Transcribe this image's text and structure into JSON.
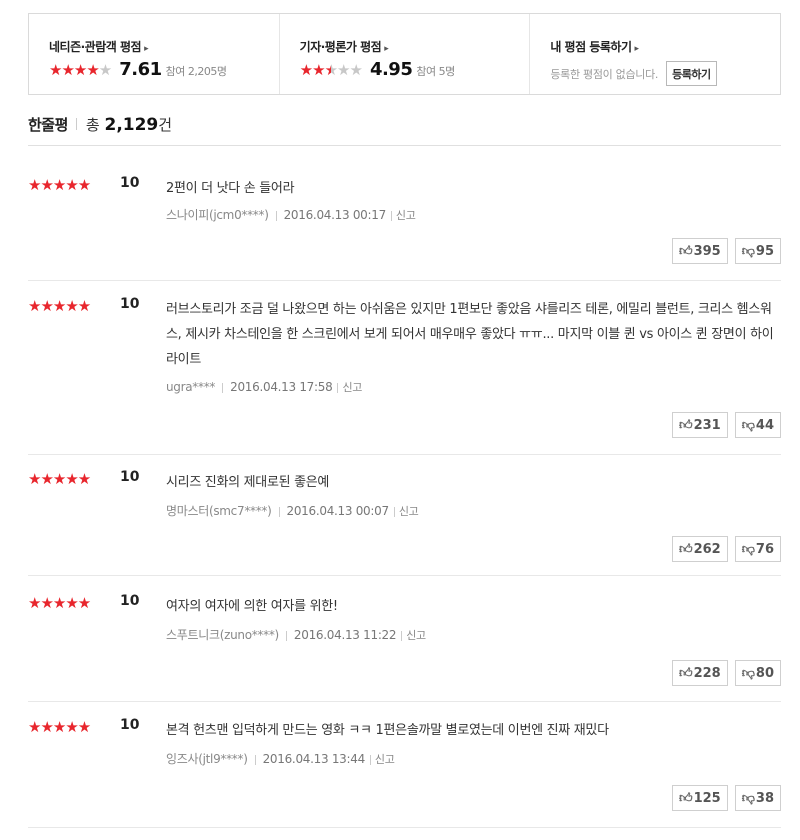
{
  "summary": {
    "netizen": {
      "label": "네티즌·관람객 평점",
      "arrow": "▸",
      "stars_on": "★★★★",
      "stars_off": "★",
      "score": "7.61",
      "participants": "참여 2,205명"
    },
    "critic": {
      "label": "기자·평론가 평점",
      "arrow": "▸",
      "stars_on": "★★",
      "stars_half": "★",
      "stars_off": "★★",
      "score": "4.95",
      "participants": "참여 5명"
    },
    "mine": {
      "label": "내 평점 등록하기",
      "arrow": "▸",
      "empty_text": "등록한 평점이 없습니다.",
      "button_label": "등록하기"
    }
  },
  "heading": {
    "title": "한줄평",
    "total_prefix": "총 ",
    "count": "2,129",
    "suffix": "건"
  },
  "colors": {
    "star": "#e8262d",
    "star_off": "#c8c8c8"
  },
  "reviews": [
    {
      "stars": "★★★★★",
      "score": "10",
      "text": "2편이 더 낫다 손 들어라",
      "user": "스나이피(jcm0****)",
      "date": "2016.04.13 00:17",
      "report": "신고",
      "up": "395",
      "down": "95"
    },
    {
      "stars": "★★★★★",
      "score": "10",
      "text": "러브스토리가 조금 덜 나왔으면 하는 아쉬움은 있지만 1편보단 좋았음 샤를리즈 테론, 에밀리 블런트, 크리스 헴스워스, 제시카 차스테인을 한 스크린에서 보게 되어서 매우매우 좋았다 ㅠㅠ... 마지막 이블 퀸 vs 아이스 퀸 장면이 하이라이트",
      "user": "ugra****",
      "date": "2016.04.13 17:58",
      "report": "신고",
      "up": "231",
      "down": "44"
    },
    {
      "stars": "★★★★★",
      "score": "10",
      "text": "시리즈 진화의 제대로된 좋은예",
      "user": "명마스터(smc7****)",
      "date": "2016.04.13 00:07",
      "report": "신고",
      "up": "262",
      "down": "76"
    },
    {
      "stars": "★★★★★",
      "score": "10",
      "text": "여자의 여자에 의한 여자를 위한!",
      "user": "스푸트니크(zuno****)",
      "date": "2016.04.13 11:22",
      "report": "신고",
      "up": "228",
      "down": "80"
    },
    {
      "stars": "★★★★★",
      "score": "10",
      "text": "본격 헌츠맨 입덕하게 만드는 영화 ㅋㅋ 1편은솔까말 별로였는데 이번엔 진짜 재밌다",
      "user": "잉즈사(jtl9****)",
      "date": "2016.04.13 13:44",
      "report": "신고",
      "up": "125",
      "down": "38"
    }
  ],
  "icons": {
    "thumb_up": "thumb-up-icon",
    "thumb_down": "thumb-down-icon"
  }
}
